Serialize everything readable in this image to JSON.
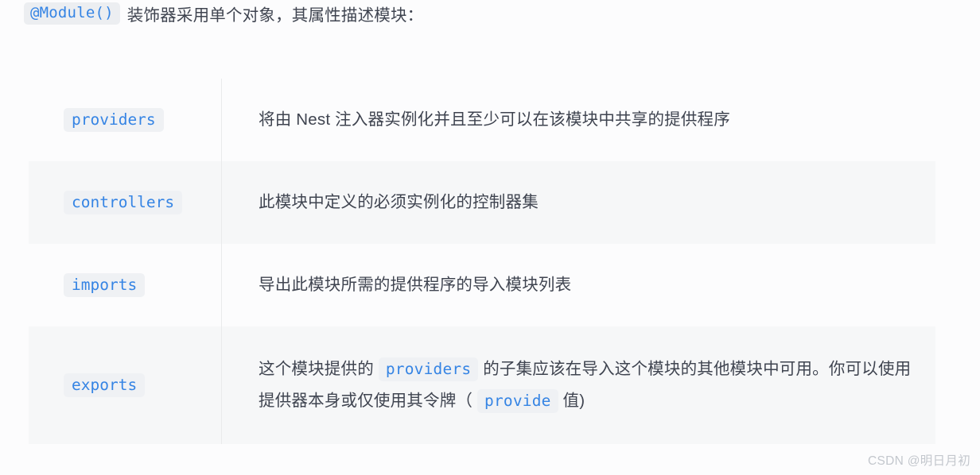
{
  "intro": {
    "code": "@Module()",
    "text": "装饰器采用单个对象，其属性描述模块："
  },
  "table": {
    "rows": [
      {
        "key": "providers",
        "desc_html": "将由 Nest 注入器实例化并且至少可以在该模块中共享的提供程序",
        "desc_plain": "将由 Nest 注入器实例化并且至少可以在该模块中共享的提供程序",
        "shaded": false
      },
      {
        "key": "controllers",
        "desc_html": "此模块中定义的必须实例化的控制器集",
        "desc_plain": "此模块中定义的必须实例化的控制器集",
        "shaded": true
      },
      {
        "key": "imports",
        "desc_html": "导出此模块所需的提供程序的导入模块列表",
        "desc_plain": "导出此模块所需的提供程序的导入模块列表",
        "shaded": false
      },
      {
        "key": "exports",
        "desc_parts": {
          "p1": "这个模块提供的",
          "code1": "providers",
          "p2": "的子集应该在导入这个模块的其他模块中可用。你可以使用提供器本身或仅使用其令牌（",
          "code2": "provide",
          "p3": "值)"
        },
        "shaded": true
      }
    ]
  },
  "watermark": "CSDN @明日月初",
  "colors": {
    "page_background": "#fcfcfd",
    "code_text": "#3584e4",
    "code_background": "#eff1f4",
    "body_text": "#3f4450",
    "row_shaded": "#f6f7f8",
    "divider": "#e9eaec",
    "watermark": "#c3c7cd"
  }
}
